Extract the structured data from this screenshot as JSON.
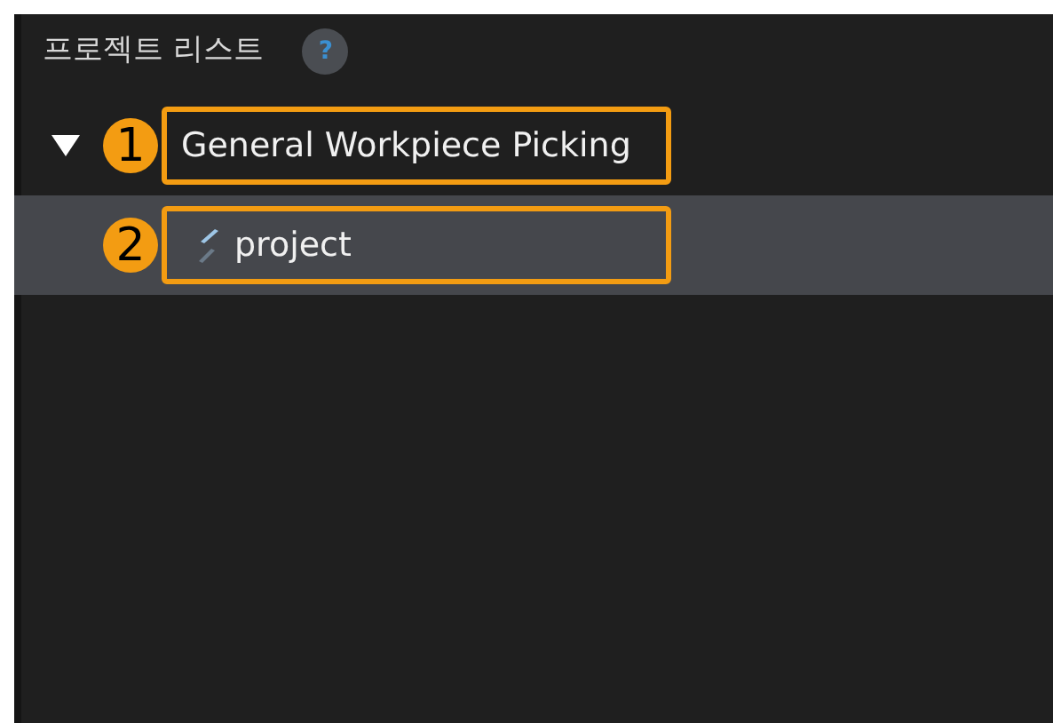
{
  "panel": {
    "title": "프로젝트 리스트",
    "help": "?"
  },
  "tree": [
    {
      "label": "General Workpiece Picking",
      "expanded": true,
      "selected": false,
      "callout": "1",
      "children": [
        {
          "label": "project",
          "selected": true,
          "callout": "2"
        }
      ]
    }
  ]
}
